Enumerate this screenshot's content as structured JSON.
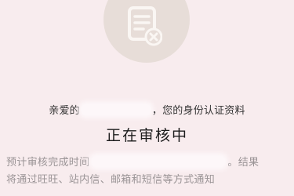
{
  "greeting": {
    "prefix": "亲爱的",
    "suffix": "，您的身份认证资料"
  },
  "status": {
    "title": "正在审核中"
  },
  "detail": {
    "line1_prefix": "预计审核完成时间",
    "line1_suffix": "。结果",
    "line2": "将通过旺旺、站内信、邮箱和短信等方式通知"
  },
  "icon": {
    "name": "document-rejected-icon",
    "circle_color": "#e7ddd8",
    "doc_color": "#faf6f3"
  }
}
